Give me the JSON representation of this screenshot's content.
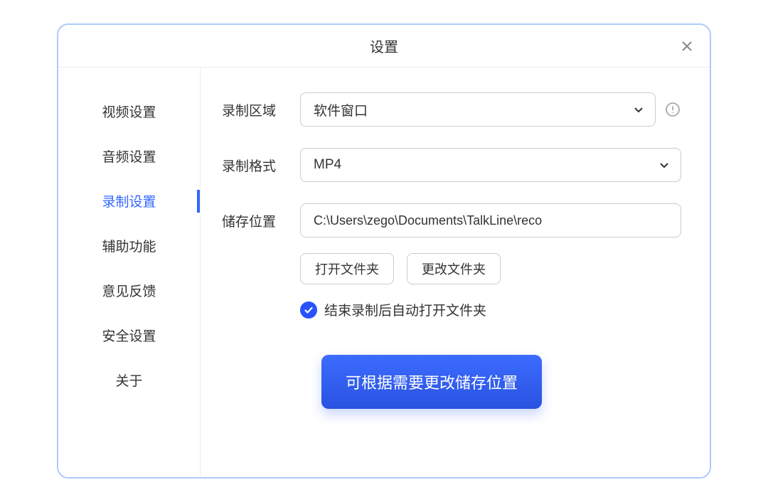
{
  "header": {
    "title": "设置"
  },
  "sidebar": {
    "items": [
      {
        "label": "视频设置",
        "name": "sidebar-item-video"
      },
      {
        "label": "音频设置",
        "name": "sidebar-item-audio"
      },
      {
        "label": "录制设置",
        "name": "sidebar-item-recording"
      },
      {
        "label": "辅助功能",
        "name": "sidebar-item-accessibility"
      },
      {
        "label": "意见反馈",
        "name": "sidebar-item-feedback"
      },
      {
        "label": "安全设置",
        "name": "sidebar-item-security"
      },
      {
        "label": "关于",
        "name": "sidebar-item-about"
      }
    ],
    "activeIndex": 2
  },
  "form": {
    "recordingArea": {
      "label": "录制区域",
      "value": "软件窗口"
    },
    "recordingFormat": {
      "label": "录制格式",
      "value": "MP4"
    },
    "storageLocation": {
      "label": "储存位置",
      "value": "C:\\Users\\zego\\Documents\\TalkLine\\reco"
    },
    "buttons": {
      "openFolder": "打开文件夹",
      "changeFolder": "更改文件夹"
    },
    "autoOpen": {
      "label": "结束录制后自动打开文件夹",
      "checked": true
    }
  },
  "tooltip": {
    "text": "可根据需要更改储存位置"
  }
}
